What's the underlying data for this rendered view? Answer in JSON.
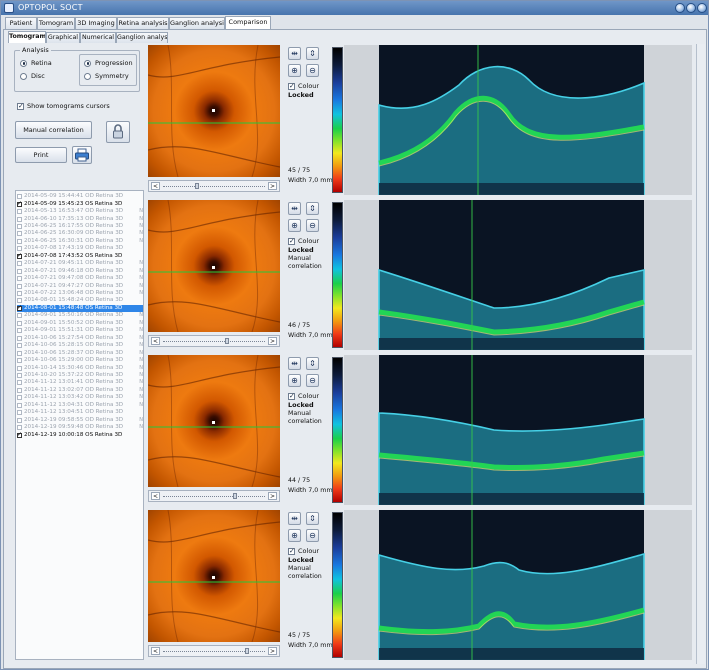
{
  "window": {
    "title": "OPTOPOL SOCT"
  },
  "main_tabs": [
    "Patient",
    "Tomogram",
    "3D Imaging",
    "Retina analysis",
    "Ganglion analysis",
    "Comparison"
  ],
  "main_tab_active": "Comparison",
  "sub_tabs": [
    "Tomograms",
    "Graphical",
    "Numerical",
    "Ganglion analysis"
  ],
  "sub_tab_active": "Tomograms",
  "analysis": {
    "label": "Analysis",
    "retina": "Retina",
    "disc": "Disc",
    "progression": "Progression",
    "symmetry": "Symmetry"
  },
  "show_cursors": "Show tomograms cursors",
  "buttons": {
    "manual_correlation": "Manual correlation",
    "print": "Print"
  },
  "exams": [
    {
      "text": "2014-05-09 15:44:41 OD Retina 3D",
      "flag": "",
      "checked": false
    },
    {
      "text": "2014-05-09 15:45:23 OS Retina 3D",
      "flag": "",
      "checked": true
    },
    {
      "text": "2014-05-13 16:53:47 OD Retina 3D",
      "flag": "N",
      "checked": false
    },
    {
      "text": "2014-06-10 17:35:13 OD Retina 3D",
      "flag": "N",
      "checked": false
    },
    {
      "text": "2014-06-25 16:17:55 OD Retina 3D",
      "flag": "N",
      "checked": false
    },
    {
      "text": "2014-06-25 16:30:09 OD Retina 3D",
      "flag": "N",
      "checked": false
    },
    {
      "text": "2014-06-25 16:30:31 OD Retina 3D",
      "flag": "N",
      "checked": false
    },
    {
      "text": "2014-07-08 17:43:19 OD Retina 3D",
      "flag": "",
      "checked": false
    },
    {
      "text": "2014-07-08 17:43:52 OS Retina 3D",
      "flag": "",
      "checked": true
    },
    {
      "text": "2014-07-21 09:45:11 OD Retina 3D",
      "flag": "N",
      "checked": false
    },
    {
      "text": "2014-07-21 09:46:18 OD Retina 3D",
      "flag": "N",
      "checked": false
    },
    {
      "text": "2014-07-21 09:47:08 OD Retina 3D",
      "flag": "N",
      "checked": false
    },
    {
      "text": "2014-07-21 09:47:27 OD Retina 3D",
      "flag": "N",
      "checked": false
    },
    {
      "text": "2014-07-22 13:06:48 OD Retina 3D",
      "flag": "N",
      "checked": false
    },
    {
      "text": "2014-08-01 15:48:24 OD Retina 3D",
      "flag": "",
      "checked": false
    },
    {
      "text": "2014-08-01 15:48:48 OS Retina 3D",
      "flag": "",
      "checked": true,
      "selected": true
    },
    {
      "text": "2014-09-01 15:50:16 OD Retina 3D",
      "flag": "N",
      "checked": false
    },
    {
      "text": "2014-09-01 15:50:52 OD Retina 3D",
      "flag": "N",
      "checked": false
    },
    {
      "text": "2014-09-01 15:51:31 OD Retina 3D",
      "flag": "N",
      "checked": false
    },
    {
      "text": "2014-10-06 15:27:54 OD Retina 3D",
      "flag": "N",
      "checked": false
    },
    {
      "text": "2014-10-06 15:28:15 OD Retina 3D",
      "flag": "N",
      "checked": false
    },
    {
      "text": "2014-10-06 15:28:37 OD Retina 3D",
      "flag": "N",
      "checked": false
    },
    {
      "text": "2014-10-06 15:29:00 OD Retina 3D",
      "flag": "N",
      "checked": false
    },
    {
      "text": "2014-10-14 15:30:46 OD Retina 3D",
      "flag": "N",
      "checked": false
    },
    {
      "text": "2014-10-20 15:37:22 OD Retina 3D",
      "flag": "N",
      "checked": false
    },
    {
      "text": "2014-11-12 13:01:41 OD Retina 3D",
      "flag": "N",
      "checked": false
    },
    {
      "text": "2014-11-12 13:02:07 OD Retina 3D",
      "flag": "N",
      "checked": false
    },
    {
      "text": "2014-11-12 13:03:42 OD Retina 3D",
      "flag": "N",
      "checked": false
    },
    {
      "text": "2014-11-12 13:04:31 OD Retina 3D",
      "flag": "N",
      "checked": false
    },
    {
      "text": "2014-11-12 13:04:51 OD Retina 3D",
      "flag": "",
      "checked": false
    },
    {
      "text": "2014-12-19 09:58:55 OD Retina 3D",
      "flag": "N",
      "checked": false
    },
    {
      "text": "2014-12-19 09:59:48 OD Retina 3D",
      "flag": "N",
      "checked": false
    },
    {
      "text": "2014-12-19 10:00:18 OS Retina 3D",
      "flag": "",
      "checked": true
    }
  ],
  "colour_label": "Colour",
  "locked_label": "Locked",
  "rows": [
    {
      "slice": "45 / 75",
      "width": "Width 7,0 mm",
      "manual": "",
      "scan_progress": 0.32
    },
    {
      "slice": "46 / 75",
      "width": "Width 7,0 mm",
      "manual": "Manual correlation",
      "scan_progress": 0.62
    },
    {
      "slice": "44 / 75",
      "width": "Width 7,0 mm",
      "manual": "Manual correlation",
      "scan_progress": 0.7
    },
    {
      "slice": "45 / 75",
      "width": "Width 7,0 mm",
      "manual": "Manual correlation",
      "scan_progress": 0.82
    }
  ],
  "icons": {
    "app": "app-logo-icon",
    "minimize": "minimize-icon",
    "maximize": "maximize-icon",
    "close": "close-icon",
    "lock": "lock-icon",
    "printer": "printer-icon",
    "fit_width": "fit-width-icon",
    "fit_height": "fit-height-icon",
    "zoom_in": "zoom-in-icon",
    "zoom_out": "zoom-out-icon"
  }
}
